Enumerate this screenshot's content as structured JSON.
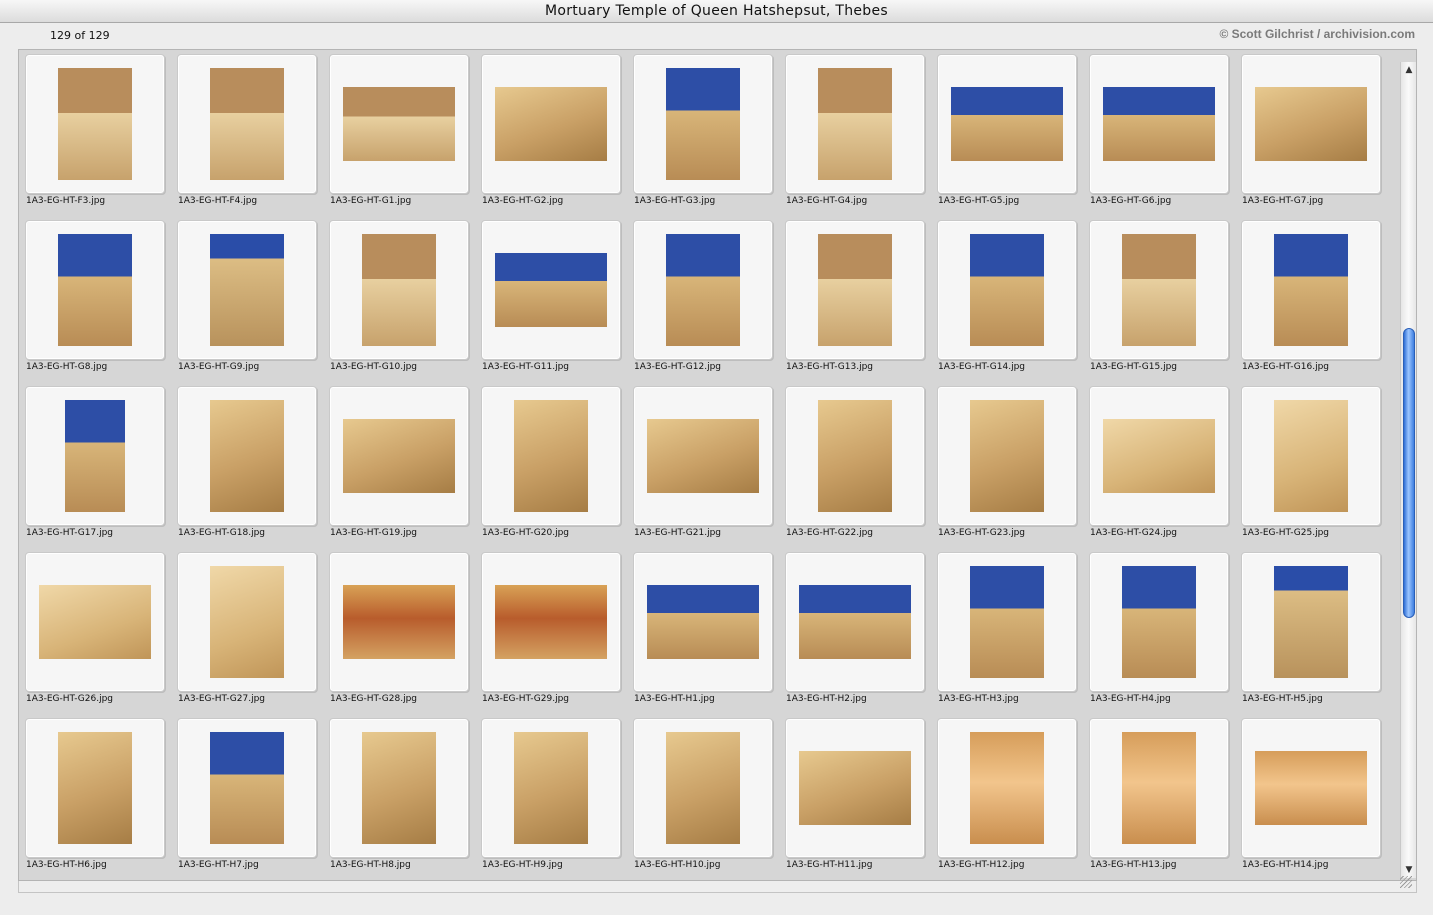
{
  "window": {
    "title": "Mortuary Temple of Queen Hatshepsut, Thebes"
  },
  "toolbar": {
    "count": "129 of 129",
    "credit": "© Scott Gilchrist / archivision.com"
  },
  "scrollbar": {
    "up_arrow": "▲",
    "down_arrow": "▼"
  },
  "files": [
    "1A3-EG-HT-F3.jpg",
    "1A3-EG-HT-F4.jpg",
    "1A3-EG-HT-G1.jpg",
    "1A3-EG-HT-G2.jpg",
    "1A3-EG-HT-G3.jpg",
    "1A3-EG-HT-G4.jpg",
    "1A3-EG-HT-G5.jpg",
    "1A3-EG-HT-G6.jpg",
    "1A3-EG-HT-G7.jpg",
    "1A3-EG-HT-G8.jpg",
    "1A3-EG-HT-G9.jpg",
    "1A3-EG-HT-G10.jpg",
    "1A3-EG-HT-G11.jpg",
    "1A3-EG-HT-G12.jpg",
    "1A3-EG-HT-G13.jpg",
    "1A3-EG-HT-G14.jpg",
    "1A3-EG-HT-G15.jpg",
    "1A3-EG-HT-G16.jpg",
    "1A3-EG-HT-G17.jpg",
    "1A3-EG-HT-G18.jpg",
    "1A3-EG-HT-G19.jpg",
    "1A3-EG-HT-G20.jpg",
    "1A3-EG-HT-G21.jpg",
    "1A3-EG-HT-G22.jpg",
    "1A3-EG-HT-G23.jpg",
    "1A3-EG-HT-G24.jpg",
    "1A3-EG-HT-G25.jpg",
    "1A3-EG-HT-G26.jpg",
    "1A3-EG-HT-G27.jpg",
    "1A3-EG-HT-G28.jpg",
    "1A3-EG-HT-G29.jpg",
    "1A3-EG-HT-H1.jpg",
    "1A3-EG-HT-H2.jpg",
    "1A3-EG-HT-H3.jpg",
    "1A3-EG-HT-H4.jpg",
    "1A3-EG-HT-H5.jpg",
    "1A3-EG-HT-H6.jpg",
    "1A3-EG-HT-H7.jpg",
    "1A3-EG-HT-H8.jpg",
    "1A3-EG-HT-H9.jpg",
    "1A3-EG-HT-H10.jpg",
    "1A3-EG-HT-H11.jpg",
    "1A3-EG-HT-H12.jpg",
    "1A3-EG-HT-H13.jpg",
    "1A3-EG-HT-H14.jpg"
  ]
}
